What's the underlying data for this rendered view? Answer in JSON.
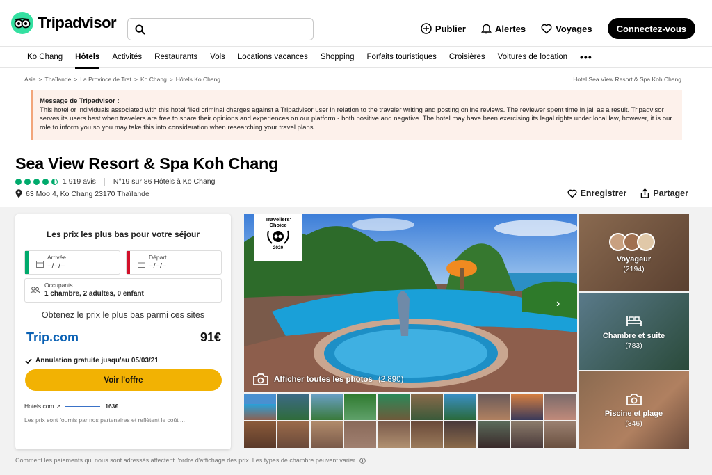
{
  "header": {
    "brand": "Tripadvisor",
    "search_placeholder": "",
    "actions": {
      "publish": "Publier",
      "alerts": "Alertes",
      "trips": "Voyages"
    },
    "connect": "Connectez-vous"
  },
  "nav": {
    "items": [
      "Ko Chang",
      "Hôtels",
      "Activités",
      "Restaurants",
      "Vols",
      "Locations vacances",
      "Shopping",
      "Forfaits touristiques",
      "Croisières",
      "Voitures de location"
    ],
    "active": "Hôtels",
    "more": "•••"
  },
  "breadcrumb": {
    "items": [
      "Asie",
      "Thaïlande",
      "La Province de Trat",
      "Ko Chang",
      "Hôtels Ko Chang"
    ],
    "separator": ">",
    "current": "Hotel Sea View Resort & Spa Koh Chang"
  },
  "message": {
    "title": "Message de Tripadvisor :",
    "body": "This hotel or individuals associated with this hotel filed criminal charges against a Tripadvisor user in relation to the traveler writing and posting online reviews. The reviewer spent time in jail as a result. Tripadvisor serves its users best when travelers are free to share their opinions and experiences on our platform - both positive and negative. The hotel may have been exercising its legal rights under local law, however, it is our role to inform you so you may take this into consideration when researching your travel plans."
  },
  "hotel": {
    "name": "Sea View Resort & Spa Koh Chang",
    "rating": 4.5,
    "reviews": "1 919 avis",
    "ranking": "N°19 sur 86 Hôtels à Ko Chang",
    "address": "63 Moo 4, Ko Chang 23170 Thaïlande",
    "save": "Enregistrer",
    "share": "Partager"
  },
  "booking": {
    "title": "Les prix les plus bas pour votre séjour",
    "arrival_label": "Arrivée",
    "arrival_value": "−/−/−",
    "departure_label": "Départ",
    "departure_value": "−/−/−",
    "guests_label": "Occupants",
    "guests_value": "1 chambre, 2 adultes, 0 enfant",
    "best_price_text": "Obtenez le prix le plus bas parmi ces sites",
    "provider": "Trip.com",
    "price": "91€",
    "cancellation": "Annulation gratuite jusqu'au 05/03/21",
    "offer_button": "Voir l'offre",
    "alt_provider": "Hotels.com",
    "alt_price": "163€",
    "partners_note": "Les prix sont fournis par nos partenaires et reflètent le coût ..."
  },
  "footnote": "Comment les paiements qui nous sont adressés affectent l'ordre d'affichage des prix. Les types de chambre peuvent varier.",
  "gallery": {
    "badge_line1": "Travellers'",
    "badge_line2": "Choice",
    "badge_year": "2020",
    "all_photos": "Afficher toutes les photos",
    "all_photos_count": "(2 890)",
    "tiles": [
      {
        "label": "Voyageur",
        "count": "(2194)"
      },
      {
        "label": "Chambre et suite",
        "count": "(783)"
      },
      {
        "label": "Piscine et plage",
        "count": "(346)"
      }
    ]
  },
  "colors": {
    "brand_green": "#34e0a1",
    "rating_green": "#00aa6c",
    "offer_yellow": "#f2b203",
    "provider_blue": "#0a61b4",
    "arrival_bar": "#00aa6c",
    "departure_bar": "#d2102a"
  }
}
